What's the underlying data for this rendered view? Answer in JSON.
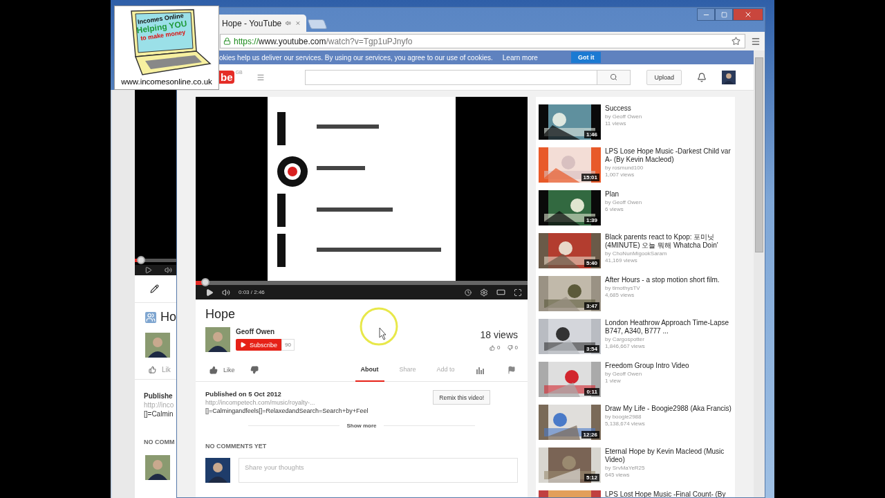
{
  "logo_overlay": {
    "lines": [
      "Incomes Online",
      "Helping YOU",
      "to make money"
    ],
    "url": "www.incomesonline.co.uk"
  },
  "background_window": {
    "title": "Ho",
    "like": "Lik",
    "published": "Publishe",
    "link": "http://inco",
    "text": "[]=Calmin",
    "comments": "NO COMM",
    "level": 0.15
  },
  "tab": {
    "title": "Hope - YouTube"
  },
  "address_bar": {
    "scheme": "https://",
    "rest": "www.youtube.com",
    "path": "/watch?v=Tgp1uPJnyfo"
  },
  "cookie_bar": {
    "text": "okies help us deliver our services. By using our services, you agree to our use of cookies.",
    "link": "Learn more",
    "button": "Got it"
  },
  "header": {
    "logo_fragment": "be",
    "region": "GB",
    "upload": "Upload"
  },
  "player": {
    "time": "0:03 / 2:46",
    "level": 0.03
  },
  "video": {
    "title": "Hope",
    "channel": "Geoff Owen",
    "subscribe": "Subscribe",
    "subscribers": "90",
    "views": "18 views",
    "likes": "0",
    "dislikes": "0",
    "like_label": "Like"
  },
  "tabs": [
    {
      "label": "About",
      "selected": true
    },
    {
      "label": "Share",
      "selected": false
    },
    {
      "label": "Add to",
      "selected": false
    }
  ],
  "description": {
    "published": "Published on 5 Oct 2012",
    "link": "http://incompetech.com/music/royalty-...",
    "text": "[]=Calmingandfeels[]=RelaxedandSearch=Search+by+Feel",
    "remix": "Remix this video!",
    "show_more": "Show more"
  },
  "comments": {
    "heading": "NO COMMENTS YET",
    "placeholder": "Share your thoughts"
  },
  "related": [
    {
      "title": "Success",
      "channel": "by Geoff Owen",
      "views": "11 views",
      "duration": "1:46"
    },
    {
      "title": "LPS Lose Hope Music -Darkest Child var A- (By Kevin Macleod)",
      "channel": "by rosmund100",
      "views": "1,007 views",
      "duration": "15:01"
    },
    {
      "title": "Plan",
      "channel": "by Geoff Owen",
      "views": "6 views",
      "duration": "1:39"
    },
    {
      "title": "Black parents react to Kpop: 포미닛 (4MINUTE) 오늘 뭐해 Whatcha Doin'",
      "channel": "by ChoNunMigookSaram",
      "views": "41,169 views",
      "duration": "5:40"
    },
    {
      "title": "After Hours - a stop motion short film.",
      "channel": "by timothysTV",
      "views": "4,685 views",
      "duration": "3:47"
    },
    {
      "title": "London Heathrow Approach Time-Lapse B747, A340, B777 ...",
      "channel": "by Cargospotter",
      "views": "1,846,667 views",
      "duration": "3:54"
    },
    {
      "title": "Freedom Group Intro Video",
      "channel": "by Geoff Owen",
      "views": "1 view",
      "duration": "0:11"
    },
    {
      "title": "Draw My Life - Boogie2988 (Aka Francis)",
      "channel": "by boogie2988",
      "views": "5,138,674 views",
      "duration": "12:26"
    },
    {
      "title": "Eternal Hope by Kevin Macleod (Music Video)",
      "channel": "by SrvMaYeR25",
      "views": "645 views",
      "duration": "5:12"
    },
    {
      "title": "LPS Lost Hope Music -Final Count- (By"
    }
  ]
}
